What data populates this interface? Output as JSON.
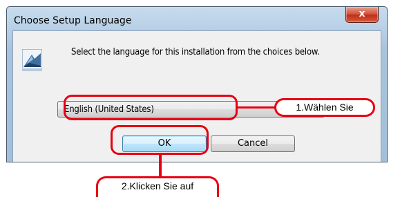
{
  "dialog": {
    "title": "Choose Setup Language",
    "close_label": "x",
    "prompt": "Select the language for this installation from the choices below.",
    "language_selected": "English (United States)",
    "ok_label": "OK",
    "cancel_label": "Cancel"
  },
  "annotations": {
    "step1": "1.Wählen Sie",
    "step2": "2.Klicken Sie auf"
  },
  "colors": {
    "annotation_red": "#e60012",
    "titlebar": "#b4cde4",
    "client": "#f0f0f0"
  },
  "icons": {
    "app": "installer-icon",
    "close": "close-icon"
  }
}
